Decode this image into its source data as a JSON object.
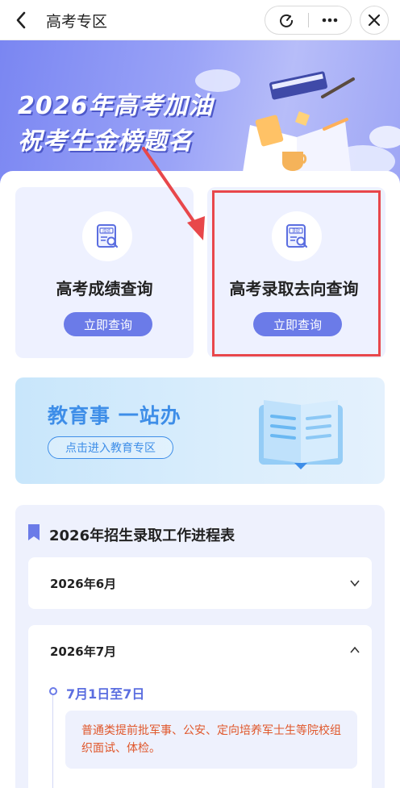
{
  "topbar": {
    "title": "高考专区"
  },
  "banner": {
    "line1": "2026年高考加油",
    "line2": "祝考生金榜题名"
  },
  "cards": [
    {
      "icon_text": "成绩",
      "title": "高考成绩查询",
      "button": "立即查询"
    },
    {
      "icon_text": "录取",
      "title": "高考录取去向查询",
      "button": "立即查询"
    }
  ],
  "edu": {
    "title": "教育事 一站办",
    "button": "点击进入教育专区"
  },
  "progress": {
    "title": "2026年招生录取工作进程表",
    "months": [
      {
        "label": "2026年6月",
        "expanded": false
      },
      {
        "label": "2026年7月",
        "expanded": true
      }
    ],
    "events": [
      {
        "date": "7月1日至7日",
        "text": "普通类提前批军事、公安、定向培养军士生等院校组织面试、体检。"
      }
    ]
  },
  "colors": {
    "accent": "#6b7be8",
    "edu": "#3e8ee8",
    "highlight": "#e8474b",
    "event_text": "#e0572b"
  }
}
